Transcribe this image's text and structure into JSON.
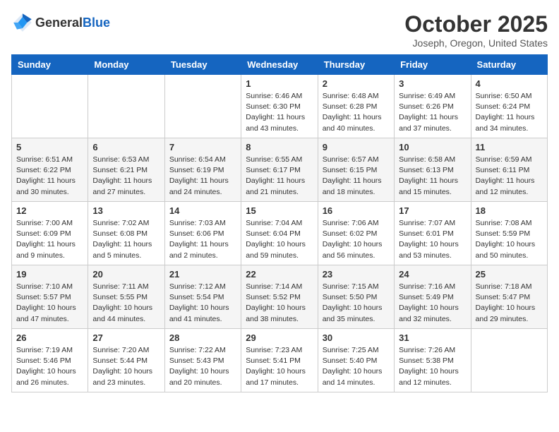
{
  "header": {
    "logo_general": "General",
    "logo_blue": "Blue",
    "month_title": "October 2025",
    "location": "Joseph, Oregon, United States"
  },
  "days_of_week": [
    "Sunday",
    "Monday",
    "Tuesday",
    "Wednesday",
    "Thursday",
    "Friday",
    "Saturday"
  ],
  "weeks": [
    [
      {
        "day": "",
        "info": ""
      },
      {
        "day": "",
        "info": ""
      },
      {
        "day": "",
        "info": ""
      },
      {
        "day": "1",
        "info": "Sunrise: 6:46 AM\nSunset: 6:30 PM\nDaylight: 11 hours\nand 43 minutes."
      },
      {
        "day": "2",
        "info": "Sunrise: 6:48 AM\nSunset: 6:28 PM\nDaylight: 11 hours\nand 40 minutes."
      },
      {
        "day": "3",
        "info": "Sunrise: 6:49 AM\nSunset: 6:26 PM\nDaylight: 11 hours\nand 37 minutes."
      },
      {
        "day": "4",
        "info": "Sunrise: 6:50 AM\nSunset: 6:24 PM\nDaylight: 11 hours\nand 34 minutes."
      }
    ],
    [
      {
        "day": "5",
        "info": "Sunrise: 6:51 AM\nSunset: 6:22 PM\nDaylight: 11 hours\nand 30 minutes."
      },
      {
        "day": "6",
        "info": "Sunrise: 6:53 AM\nSunset: 6:21 PM\nDaylight: 11 hours\nand 27 minutes."
      },
      {
        "day": "7",
        "info": "Sunrise: 6:54 AM\nSunset: 6:19 PM\nDaylight: 11 hours\nand 24 minutes."
      },
      {
        "day": "8",
        "info": "Sunrise: 6:55 AM\nSunset: 6:17 PM\nDaylight: 11 hours\nand 21 minutes."
      },
      {
        "day": "9",
        "info": "Sunrise: 6:57 AM\nSunset: 6:15 PM\nDaylight: 11 hours\nand 18 minutes."
      },
      {
        "day": "10",
        "info": "Sunrise: 6:58 AM\nSunset: 6:13 PM\nDaylight: 11 hours\nand 15 minutes."
      },
      {
        "day": "11",
        "info": "Sunrise: 6:59 AM\nSunset: 6:11 PM\nDaylight: 11 hours\nand 12 minutes."
      }
    ],
    [
      {
        "day": "12",
        "info": "Sunrise: 7:00 AM\nSunset: 6:09 PM\nDaylight: 11 hours\nand 9 minutes."
      },
      {
        "day": "13",
        "info": "Sunrise: 7:02 AM\nSunset: 6:08 PM\nDaylight: 11 hours\nand 5 minutes."
      },
      {
        "day": "14",
        "info": "Sunrise: 7:03 AM\nSunset: 6:06 PM\nDaylight: 11 hours\nand 2 minutes."
      },
      {
        "day": "15",
        "info": "Sunrise: 7:04 AM\nSunset: 6:04 PM\nDaylight: 10 hours\nand 59 minutes."
      },
      {
        "day": "16",
        "info": "Sunrise: 7:06 AM\nSunset: 6:02 PM\nDaylight: 10 hours\nand 56 minutes."
      },
      {
        "day": "17",
        "info": "Sunrise: 7:07 AM\nSunset: 6:01 PM\nDaylight: 10 hours\nand 53 minutes."
      },
      {
        "day": "18",
        "info": "Sunrise: 7:08 AM\nSunset: 5:59 PM\nDaylight: 10 hours\nand 50 minutes."
      }
    ],
    [
      {
        "day": "19",
        "info": "Sunrise: 7:10 AM\nSunset: 5:57 PM\nDaylight: 10 hours\nand 47 minutes."
      },
      {
        "day": "20",
        "info": "Sunrise: 7:11 AM\nSunset: 5:55 PM\nDaylight: 10 hours\nand 44 minutes."
      },
      {
        "day": "21",
        "info": "Sunrise: 7:12 AM\nSunset: 5:54 PM\nDaylight: 10 hours\nand 41 minutes."
      },
      {
        "day": "22",
        "info": "Sunrise: 7:14 AM\nSunset: 5:52 PM\nDaylight: 10 hours\nand 38 minutes."
      },
      {
        "day": "23",
        "info": "Sunrise: 7:15 AM\nSunset: 5:50 PM\nDaylight: 10 hours\nand 35 minutes."
      },
      {
        "day": "24",
        "info": "Sunrise: 7:16 AM\nSunset: 5:49 PM\nDaylight: 10 hours\nand 32 minutes."
      },
      {
        "day": "25",
        "info": "Sunrise: 7:18 AM\nSunset: 5:47 PM\nDaylight: 10 hours\nand 29 minutes."
      }
    ],
    [
      {
        "day": "26",
        "info": "Sunrise: 7:19 AM\nSunset: 5:46 PM\nDaylight: 10 hours\nand 26 minutes."
      },
      {
        "day": "27",
        "info": "Sunrise: 7:20 AM\nSunset: 5:44 PM\nDaylight: 10 hours\nand 23 minutes."
      },
      {
        "day": "28",
        "info": "Sunrise: 7:22 AM\nSunset: 5:43 PM\nDaylight: 10 hours\nand 20 minutes."
      },
      {
        "day": "29",
        "info": "Sunrise: 7:23 AM\nSunset: 5:41 PM\nDaylight: 10 hours\nand 17 minutes."
      },
      {
        "day": "30",
        "info": "Sunrise: 7:25 AM\nSunset: 5:40 PM\nDaylight: 10 hours\nand 14 minutes."
      },
      {
        "day": "31",
        "info": "Sunrise: 7:26 AM\nSunset: 5:38 PM\nDaylight: 10 hours\nand 12 minutes."
      },
      {
        "day": "",
        "info": ""
      }
    ]
  ]
}
